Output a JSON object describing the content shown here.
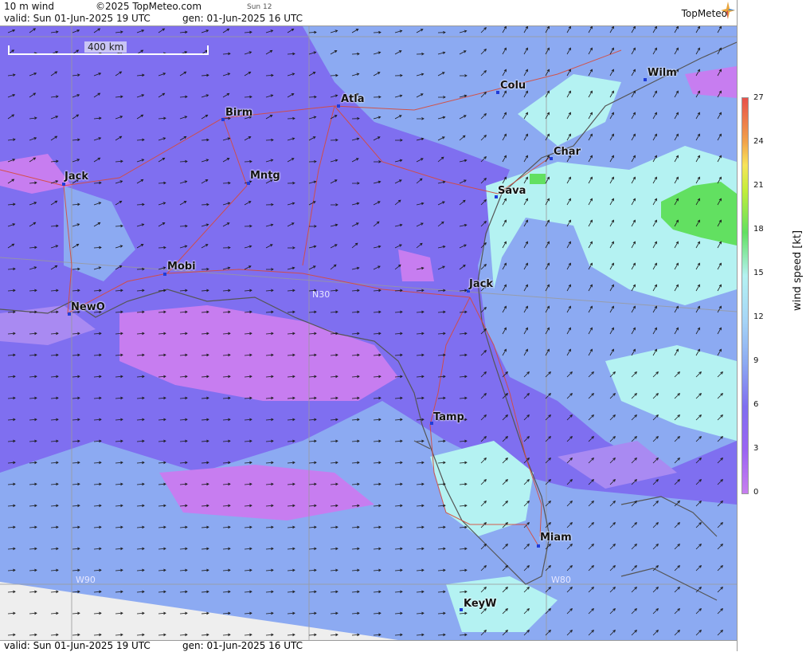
{
  "header": {
    "product": "10 m wind",
    "copyright": "©2025 TopMeteo.com",
    "run_tag": "Sun 12",
    "valid": "valid:  Sun  01-Jun-2025  19 UTC",
    "gen": "gen: 01-Jun-2025 16 UTC",
    "logo": "TopMeteo"
  },
  "footer": {
    "valid": "valid:  Sun  01-Jun-2025  19 UTC",
    "gen": "gen: 01-Jun-2025 16 UTC"
  },
  "map": {
    "scale_label": "400 km",
    "lat_label": "N30",
    "lon_labels": [
      "W90",
      "W80"
    ],
    "cities": [
      {
        "name": "Wilm"
      },
      {
        "name": "Colu"
      },
      {
        "name": "Atla"
      },
      {
        "name": "Birm"
      },
      {
        "name": "Char"
      },
      {
        "name": "Jack"
      },
      {
        "name": "Mntg"
      },
      {
        "name": "Sava"
      },
      {
        "name": "Mobi"
      },
      {
        "name": "Jack"
      },
      {
        "name": "NewO"
      },
      {
        "name": "Tamp"
      },
      {
        "name": "Miam"
      },
      {
        "name": "KeyW"
      }
    ]
  },
  "legend": {
    "title": "wind speed  [kt]",
    "ticks": [
      "27",
      "24",
      "21",
      "18",
      "15",
      "12",
      "9",
      "6",
      "3",
      "0"
    ]
  },
  "colors": {
    "calm": "#c77df0",
    "light": "#7f6ff0",
    "moderate": "#8caaf2",
    "fresh": "#b4f2f2",
    "strong": "#62e061"
  }
}
